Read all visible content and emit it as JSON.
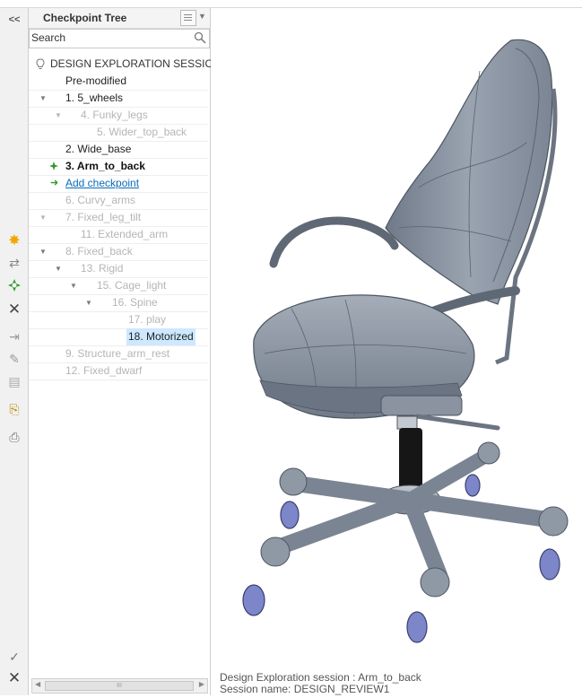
{
  "panel": {
    "title": "Checkpoint Tree",
    "collapse_label": "<<",
    "search_placeholder": "Search"
  },
  "tree": {
    "root": "DESIGN EXPLORATION SESSION",
    "items": [
      {
        "label": "Pre-modified"
      },
      {
        "label": "1. 5_wheels"
      },
      {
        "label": "4. Funky_legs"
      },
      {
        "label": "5. Wider_top_back"
      },
      {
        "label": "2. Wide_base"
      },
      {
        "label": "3. Arm_to_back"
      },
      {
        "label": "Add checkpoint"
      },
      {
        "label": "6. Curvy_arms"
      },
      {
        "label": "7. Fixed_leg_tilt"
      },
      {
        "label": "11. Extended_arm"
      },
      {
        "label": "8. Fixed_back"
      },
      {
        "label": "13. Rigid"
      },
      {
        "label": "15. Cage_light"
      },
      {
        "label": "16. Spine"
      },
      {
        "label": "17. play"
      },
      {
        "label": "18. Motorized"
      },
      {
        "label": "9. Structure_arm_rest"
      },
      {
        "label": "12. Fixed_dwarf"
      }
    ]
  },
  "scrollbar": {
    "thumb_label": "III"
  },
  "status": {
    "line1": "Design Exploration session : Arm_to_back",
    "line2": "Session name: DESIGN_REVIEW1"
  },
  "colors": {
    "accent": "#0b6bb8",
    "selection": "#cde8ff",
    "model": "#8e98a6"
  }
}
